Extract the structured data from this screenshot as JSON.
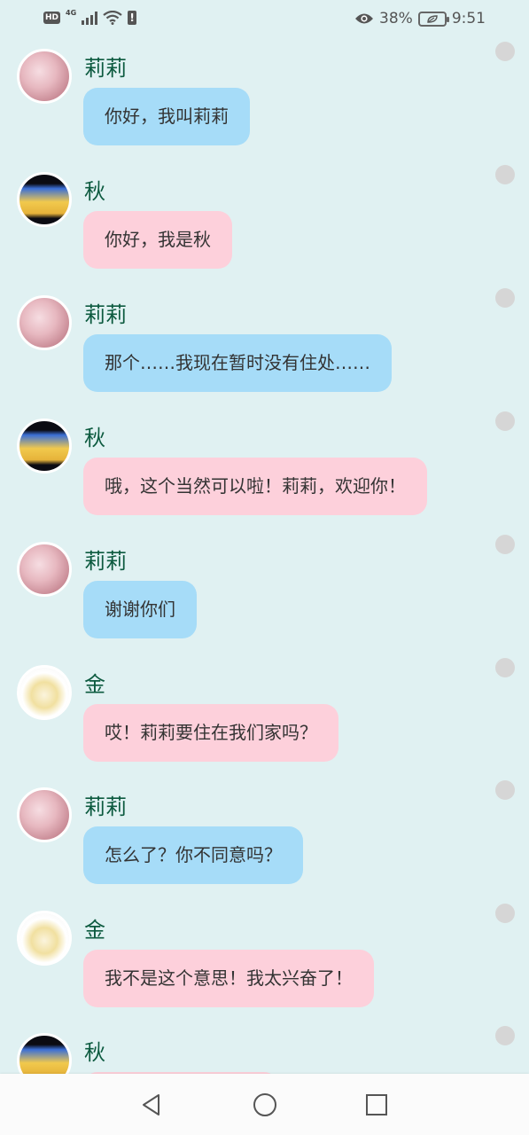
{
  "status_bar": {
    "hd_label": "HD",
    "network_label": "4G",
    "battery_percent": "38%",
    "time": "9:51"
  },
  "messages": [
    {
      "sender": "莉莉",
      "avatar": "lili",
      "text": "你好，我叫莉莉",
      "bubble_color": "#a6dcf8"
    },
    {
      "sender": "秋",
      "avatar": "qiu",
      "text": "你好，我是秋",
      "bubble_color": "#fdd0db"
    },
    {
      "sender": "莉莉",
      "avatar": "lili",
      "text": "那个……我现在暂时没有住处……",
      "bubble_color": "#a6dcf8"
    },
    {
      "sender": "秋",
      "avatar": "qiu",
      "text": "哦，这个当然可以啦！莉莉，欢迎你！",
      "bubble_color": "#fdd0db"
    },
    {
      "sender": "莉莉",
      "avatar": "lili",
      "text": "谢谢你们",
      "bubble_color": "#a6dcf8"
    },
    {
      "sender": "金",
      "avatar": "jin",
      "text": "哎！莉莉要住在我们家吗？",
      "bubble_color": "#fdd0db"
    },
    {
      "sender": "莉莉",
      "avatar": "lili",
      "text": "怎么了？你不同意吗？",
      "bubble_color": "#a6dcf8"
    },
    {
      "sender": "金",
      "avatar": "jin",
      "text": "我不是这个意思！我太兴奋了！",
      "bubble_color": "#fdd0db"
    },
    {
      "sender": "秋",
      "avatar": "qiu",
      "text": "",
      "bubble_color": "#fdd0db"
    }
  ],
  "nav_bar": {
    "back_icon": "triangle-back-icon",
    "home_icon": "circle-home-icon",
    "recents_icon": "square-recents-icon"
  }
}
